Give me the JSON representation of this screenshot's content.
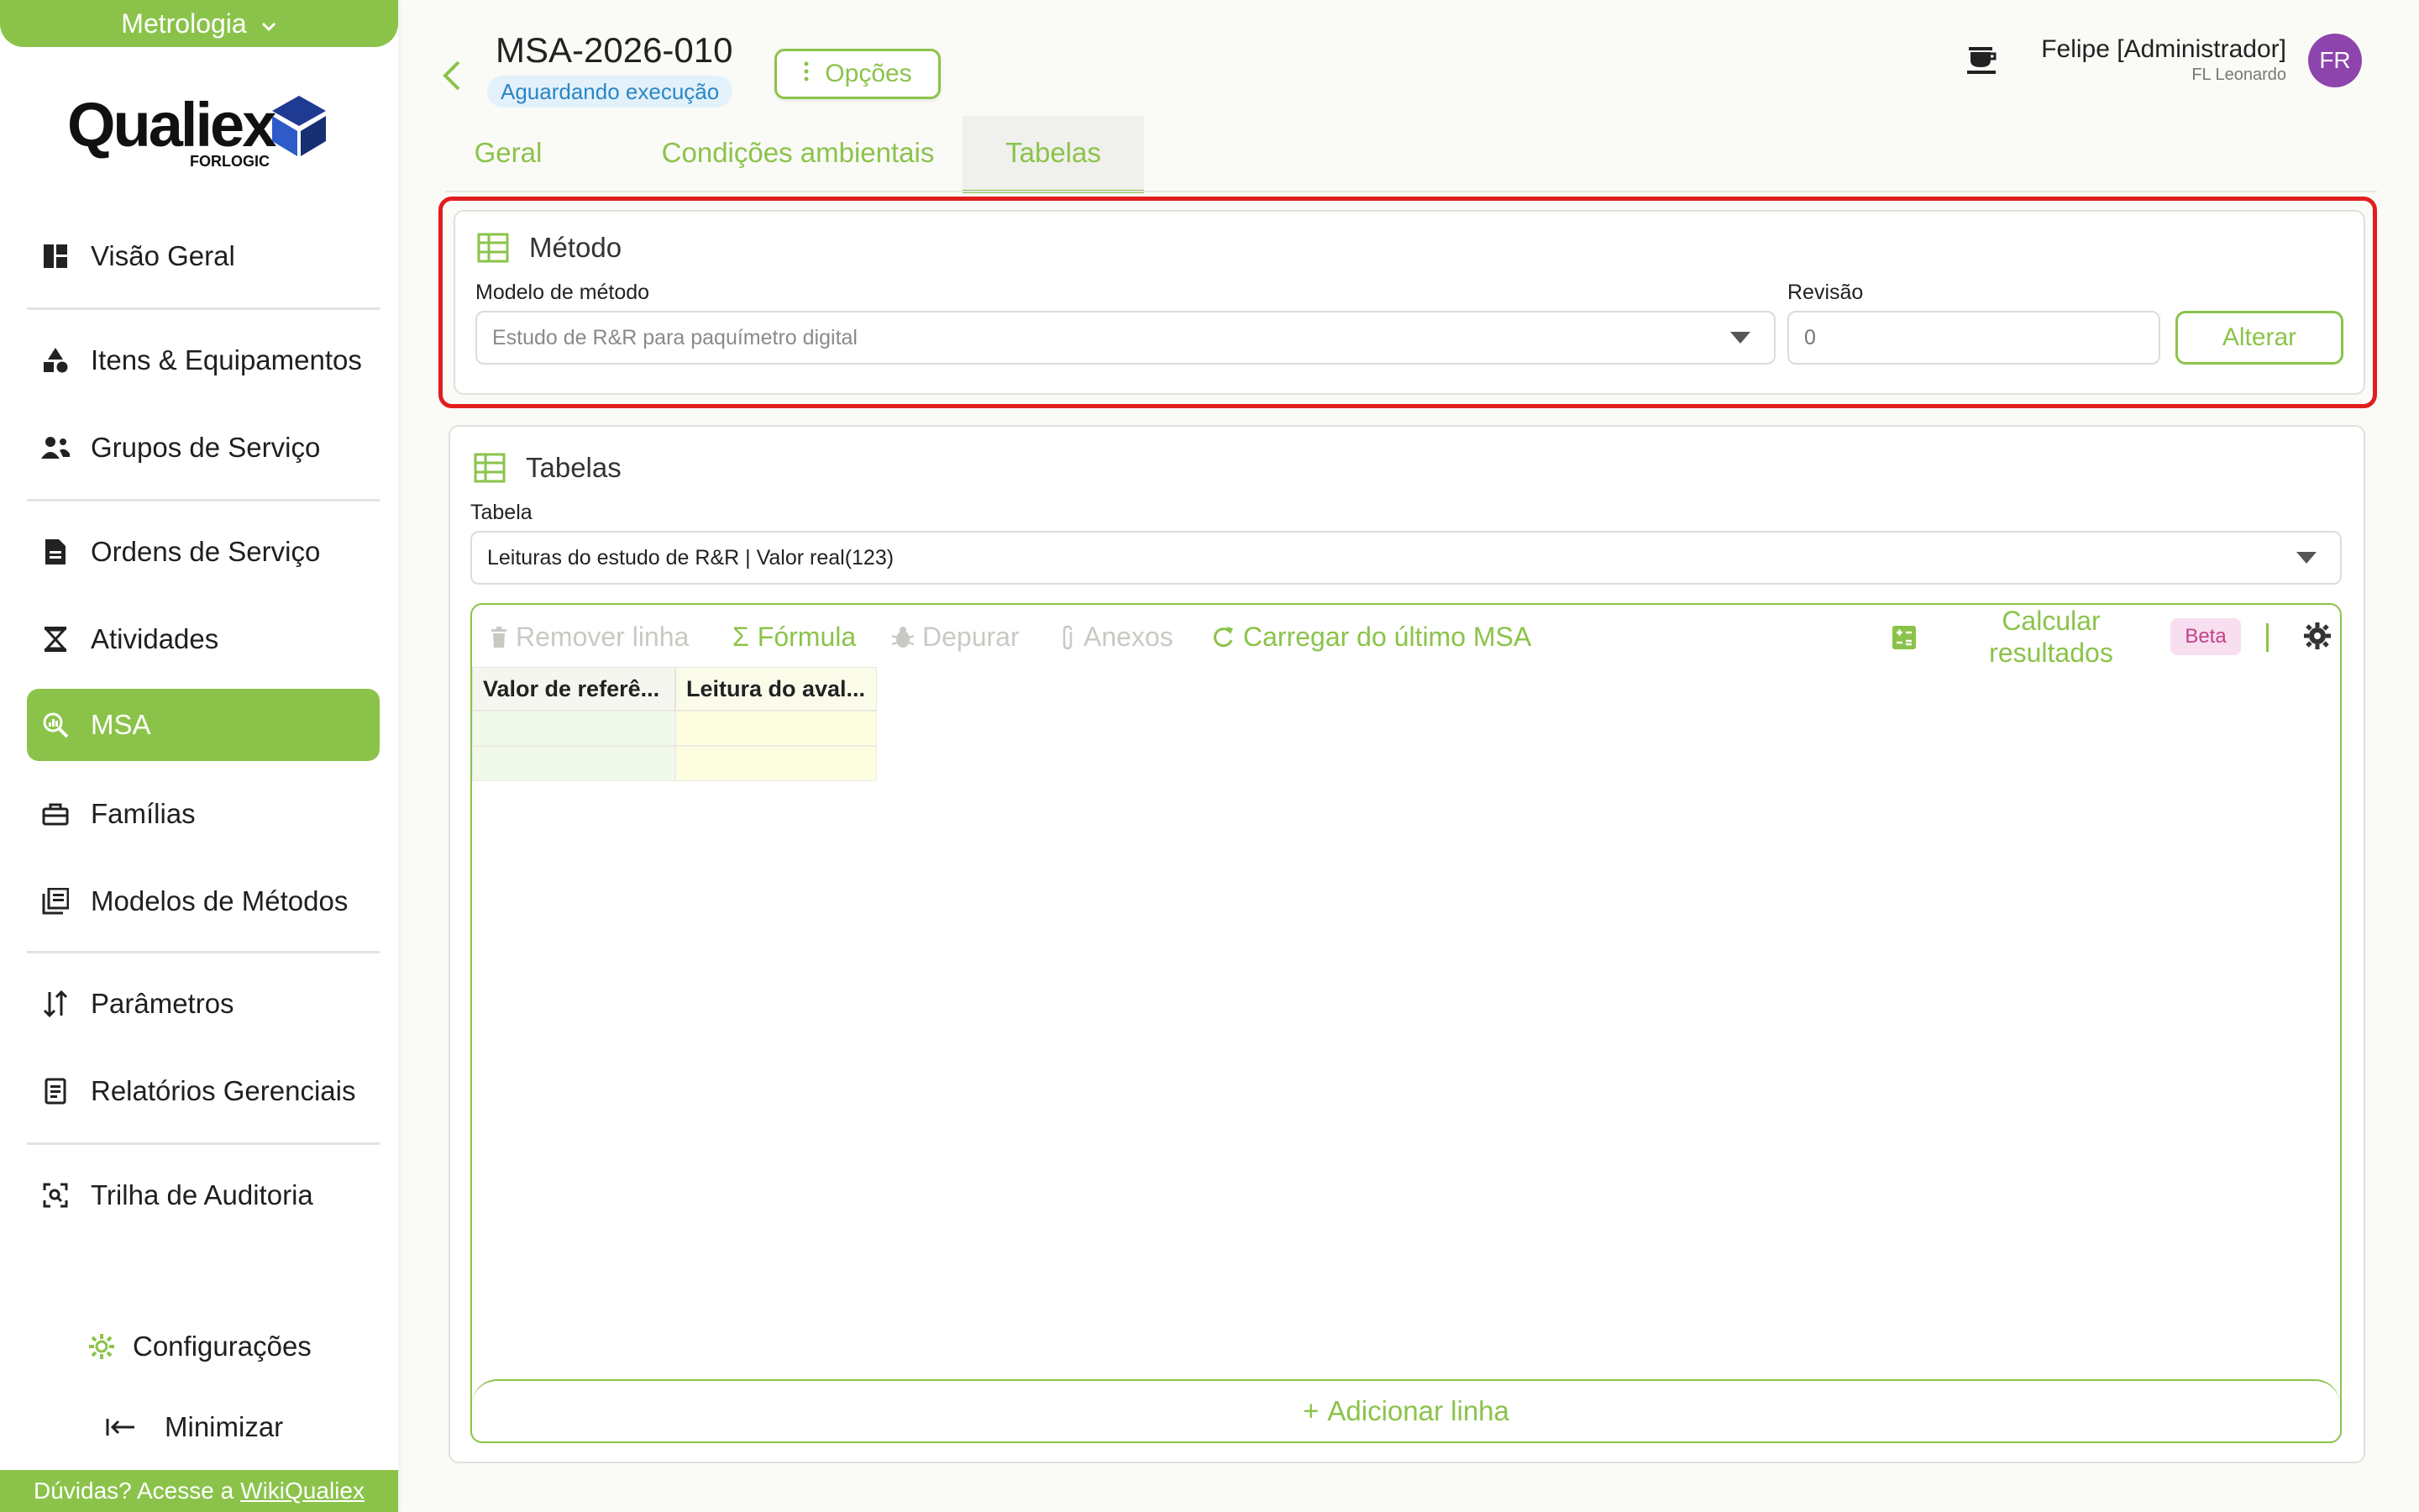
{
  "sidebar": {
    "module": "Metrologia",
    "logo_text": "Qualiex",
    "logo_sub": "FORLOGIC",
    "items": [
      {
        "label": "Visão Geral",
        "icon": "dashboard-icon"
      },
      {
        "label": "Itens & Equipamentos",
        "icon": "shapes-icon"
      },
      {
        "label": "Grupos de Serviço",
        "icon": "group-icon"
      },
      {
        "label": "Ordens de Serviço",
        "icon": "document-icon"
      },
      {
        "label": "Atividades",
        "icon": "hourglass-icon"
      },
      {
        "label": "MSA",
        "icon": "search-analytics-icon"
      },
      {
        "label": "Famílias",
        "icon": "toolbox-icon"
      },
      {
        "label": "Modelos de Métodos",
        "icon": "library-icon"
      },
      {
        "label": "Parâmetros",
        "icon": "sort-icon"
      },
      {
        "label": "Relatórios Gerenciais",
        "icon": "report-icon"
      },
      {
        "label": "Trilha de Auditoria",
        "icon": "audit-icon"
      }
    ],
    "settings_label": "Configurações",
    "minimize_label": "Minimizar",
    "help_text": "Dúvidas? Acesse a",
    "help_link": "WikiQualiex"
  },
  "header": {
    "title": "MSA-2026-010",
    "status": "Aguardando execução",
    "options_label": "Opções",
    "user_name": "Felipe [Administrador]",
    "user_org": "FL Leonardo",
    "avatar_initials": "FR"
  },
  "tabs": [
    {
      "label": "Geral"
    },
    {
      "label": "Condições ambientais"
    },
    {
      "label": "Tabelas"
    }
  ],
  "metodo": {
    "title": "Método",
    "model_label": "Modelo de método",
    "model_value": "Estudo de R&R para paquímetro digital",
    "revision_label": "Revisão",
    "revision_placeholder": "0",
    "alterar_label": "Alterar"
  },
  "tabelas": {
    "title": "Tabelas",
    "table_label": "Tabela",
    "table_value": "Leituras do estudo de R&R | Valor real(123)",
    "toolbar": {
      "remove_row": "Remover linha",
      "formula": "Fórmula",
      "debug": "Depurar",
      "attachments": "Anexos",
      "load_last": "Carregar do último MSA",
      "calc_line1": "Calcular",
      "calc_line2": "resultados",
      "beta": "Beta"
    },
    "columns": [
      "Valor de referê...",
      "Leitura do aval..."
    ],
    "add_row_label": "Adicionar linha"
  },
  "colors": {
    "accent": "#8bc34a",
    "highlight": "#e01e1e",
    "status_text": "#2a86c6",
    "avatar": "#8e44ad",
    "col1_fill": "#f1f9ea",
    "col2_fill": "#fdfde0"
  }
}
